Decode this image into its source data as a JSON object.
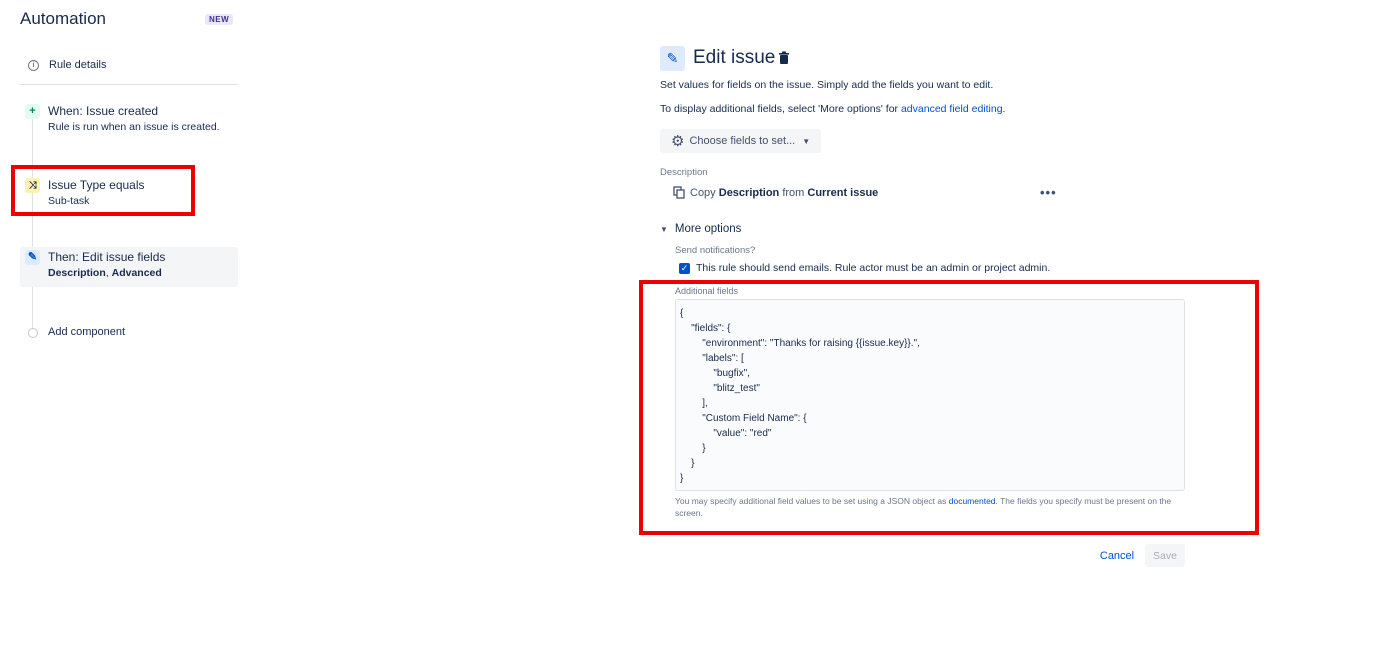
{
  "sidebar": {
    "app_title": "Automation",
    "badge": "NEW",
    "rule_details": {
      "label": "Rule details",
      "icon": "info-icon"
    },
    "trigger": {
      "title": "When: Issue created",
      "subtitle": "Rule is run when an issue is created.",
      "icon": "plus-icon"
    },
    "condition": {
      "title": "Issue Type equals",
      "subtitle": "Sub-task",
      "icon": "shuffle-icon"
    },
    "action": {
      "title": "Then: Edit issue fields",
      "subtitle_a": "Description",
      "subtitle_sep": ", ",
      "subtitle_b": "Advanced",
      "icon": "pencil-icon"
    },
    "add_component": "Add component"
  },
  "panel": {
    "title": "Edit issue",
    "desc_line1": "Set values for fields on the issue. Simply add the fields you want to edit.",
    "desc_line2_prefix": "To display additional fields, select 'More options' for ",
    "desc_line2_link": "advanced field editing",
    "desc_line2_suffix": ".",
    "choose_fields": "Choose fields to set...",
    "field_label": "Description",
    "copy_word": "Copy",
    "copy_field": "Description",
    "copy_from": "from",
    "copy_source": "Current issue",
    "more_options": "More options",
    "send_notifications_label": "Send notifications?",
    "send_notifications_checked": true,
    "send_notifications_text": "This rule should send emails. Rule actor must be an admin or project admin.",
    "additional_fields_label": "Additional fields",
    "json_lines": [
      "{",
      "    \"fields\": {",
      "        \"environment\": \"Thanks for raising {{issue.key}}.\",",
      "        \"labels\": [",
      "            \"bugfix\",",
      "            \"blitz_test\"",
      "        ],",
      "        \"Custom Field Name\": {",
      "            \"value\": \"red\"",
      "        }",
      "    }",
      "}"
    ],
    "help_prefix": "You may specify additional field values to be set using a JSON object as ",
    "help_link": "documented",
    "help_suffix": ". The fields you specify must be present on the screen.",
    "cancel": "Cancel",
    "save": "Save"
  },
  "colors": {
    "accent": "#0052cc",
    "highlight": "#ee0000",
    "text": "#172b4d",
    "muted": "#6b778c"
  }
}
